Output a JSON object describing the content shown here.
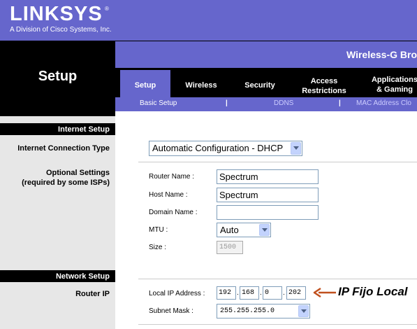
{
  "brand": {
    "logo": "LINKSYS",
    "registered": "®",
    "subtitle": "A Division of Cisco Systems, Inc."
  },
  "product": "Wireless-G Bro",
  "page_title": "Setup",
  "tabs": [
    {
      "label": "Setup",
      "active": true
    },
    {
      "label": "Wireless"
    },
    {
      "label": "Security"
    },
    {
      "label_line1": "Access",
      "label_line2": "Restrictions"
    },
    {
      "label_line1": "Applications",
      "label_line2": "& Gaming"
    }
  ],
  "subtabs": {
    "basic": "Basic Setup",
    "ddns": "DDNS",
    "mac": "MAC Address Clo",
    "separator": "|"
  },
  "sections": {
    "internet_setup": "Internet Setup",
    "network_setup": "Network Setup"
  },
  "left_labels": {
    "connection_type": "Internet Connection Type",
    "optional_line1": "Optional Settings",
    "optional_line2": "(required by some ISPs)",
    "router_ip": "Router IP"
  },
  "form": {
    "connection_type_value": "Automatic Configuration - DHCP",
    "router_name_label": "Router Name :",
    "router_name_value": "Spectrum",
    "host_name_label": "Host Name :",
    "host_name_value": "Spectrum",
    "domain_name_label": "Domain Name :",
    "domain_name_value": "",
    "mtu_label": "MTU :",
    "mtu_value": "Auto",
    "size_label": "Size :",
    "size_value": "1500",
    "local_ip_label": "Local IP Address :",
    "local_ip": [
      "192",
      "168",
      "0",
      "202"
    ],
    "ip_dot": ".",
    "subnet_label": "Subnet Mask :",
    "subnet_value": "255.255.255.0"
  },
  "annotation": "IP Fijo Local",
  "colors": {
    "brand_purple": "#6666cc",
    "black": "#000000",
    "left_gray": "#e7e7e7",
    "annotation_arrow": "#c0501e"
  },
  "icons": {
    "dropdown": "chevron-down-icon",
    "annotation_arrow": "arrow-left-icon"
  }
}
